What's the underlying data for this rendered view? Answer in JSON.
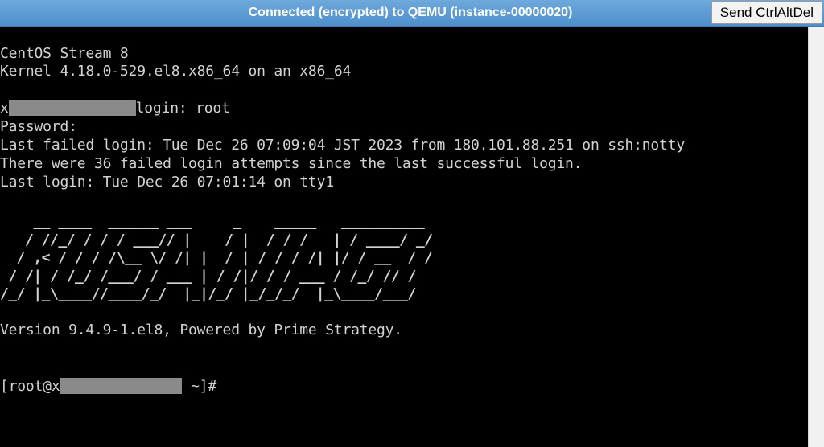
{
  "window": {
    "title": "Connected (encrypted) to QEMU (instance-00000020)",
    "send_button": "Send CtrlAltDel"
  },
  "console": {
    "os_line": "CentOS Stream 8",
    "kernel_line": "Kernel 4.18.0-529.el8.x86_64 on an x86_64",
    "login_prefix": "x",
    "login_suffix": "login: root",
    "password_line": "Password:",
    "last_failed_line": "Last failed login: Tue Dec 26 07:09:04 JST 2023 from 180.101.88.251 on ssh:notty",
    "failed_attempts_line": "There were 36 failed login attempts since the last successful login.",
    "last_login_line": "Last login: Tue Dec 26 07:01:14 on tty1",
    "banner_ascii": "    __ ____  ______ ___     _    _____   __________\n   / //_/ / / / ___// |    / |  / / /   | / ____/ _/\n  / ,< / / / /\\__ \\/ /| |  / | / / / /| |/ / __  / /\n / /| / /_/ /___/ / ___ | / /|/ / / ___ / /_/ // /\n/_/ |_\\____//____/_/  |_|/_/ |_/_/_/  |_\\____/___/",
    "version_line": "Version 9.4.9-1.el8, Powered by Prime Strategy.",
    "prompt_prefix": "[root@x",
    "prompt_suffix": " ~]#"
  }
}
